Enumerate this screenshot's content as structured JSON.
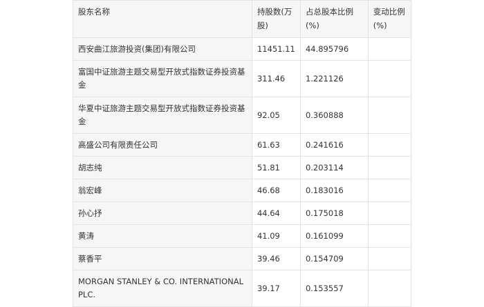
{
  "table": {
    "headers": {
      "name": "股东名称",
      "shares": "持股数(万股)",
      "ratio": "占总股本比例(%)",
      "change": "变动比例(%)"
    },
    "rows": [
      {
        "name": "西安曲江旅游投资(集团)有限公司",
        "shares": "11451.11",
        "ratio": "44.895796",
        "change": ""
      },
      {
        "name": "富国中证旅游主题交易型开放式指数证券投资基金",
        "shares": "311.46",
        "ratio": "1.221126",
        "change": ""
      },
      {
        "name": "华夏中证旅游主题交易型开放式指数证券投资基金",
        "shares": "92.05",
        "ratio": "0.360888",
        "change": ""
      },
      {
        "name": "高盛公司有限责任公司",
        "shares": "61.63",
        "ratio": "0.241616",
        "change": ""
      },
      {
        "name": "胡志纯",
        "shares": "51.81",
        "ratio": "0.203114",
        "change": ""
      },
      {
        "name": "翁宏峰",
        "shares": "46.68",
        "ratio": "0.183016",
        "change": ""
      },
      {
        "name": "孙心抒",
        "shares": "44.64",
        "ratio": "0.175018",
        "change": ""
      },
      {
        "name": "黄涛",
        "shares": "41.09",
        "ratio": "0.161099",
        "change": ""
      },
      {
        "name": "蔡香平",
        "shares": "39.46",
        "ratio": "0.154709",
        "change": ""
      },
      {
        "name": "MORGAN STANLEY & CO. INTERNATIONAL PLC.",
        "shares": "39.17",
        "ratio": "0.153557",
        "change": ""
      }
    ]
  }
}
